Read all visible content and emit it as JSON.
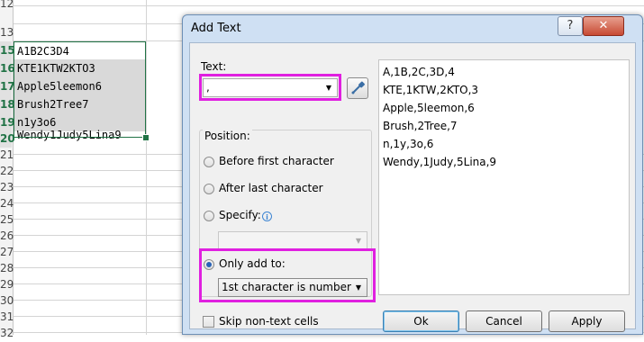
{
  "sheet": {
    "row_numbers": [
      "12",
      "13",
      "15",
      "16",
      "17",
      "18",
      "19",
      "20",
      "21",
      "22",
      "23",
      "24",
      "25",
      "26",
      "27",
      "28",
      "29",
      "30",
      "31",
      "32"
    ],
    "cells": [
      "A1B2C3D4",
      "KTE1KTW2KTO3",
      "Apple5leemon6",
      "Brush2Tree7",
      "n1y3o6",
      "Wendy1Judy5Lina9"
    ]
  },
  "dialog": {
    "title": "Add Text",
    "help_label": "?",
    "close_label": "✕",
    "text_label": "Text:",
    "text_value": ",",
    "position_label": "Position:",
    "options": {
      "before_first": "Before first character",
      "after_last": "After last character",
      "specify": "Specify:",
      "only_add_to": "Only add to:"
    },
    "specify_value": "",
    "only_add_to_value": "1st character is number",
    "skip_label": "Skip non-text cells",
    "preview": [
      "A,1B,2C,3D,4",
      "KTE,1KTW,2KTO,3",
      "Apple,5leemon,6",
      "Brush,2Tree,7",
      "n,1y,3o,6",
      "Wendy,1Judy,5Lina,9"
    ],
    "ok_label": "Ok",
    "cancel_label": "Cancel",
    "apply_label": "Apply",
    "selected_option": "only_add_to",
    "highlight_color": "#e020e0"
  }
}
